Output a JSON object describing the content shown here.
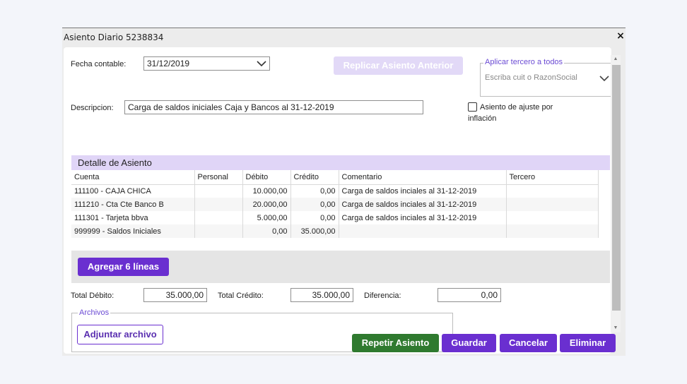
{
  "window": {
    "title": "Asiento Diario 5238834",
    "close_label": "×"
  },
  "form": {
    "fecha_label": "Fecha contable:",
    "fecha_value": "31/12/2019",
    "replicar_label": "Replicar Asiento Anterior",
    "tercero_legend": "Aplicar tercero a todos",
    "tercero_placeholder": "Escriba cuit o RazonSocial",
    "descripcion_label": "Descripcion:",
    "descripcion_value": "Carga de saldos iniciales Caja y Bancos al 31-12-2019",
    "ajuste_label_line1": "Asiento de ajuste por",
    "ajuste_label_line2": "inflación",
    "ajuste_checked": false
  },
  "detalle": {
    "title": "Detalle de Asiento",
    "columns": [
      "Cuenta",
      "Personal",
      "Débito",
      "Crédito",
      "Comentario",
      "Tercero"
    ],
    "rows": [
      [
        "111100 - CAJA CHICA",
        "",
        "10.000,00",
        "0,00",
        "Carga de saldos inciales al 31-12-2019",
        ""
      ],
      [
        "111210 - Cta Cte Banco B",
        "",
        "20.000,00",
        "0,00",
        "Carga de saldos inciales al 31-12-2019",
        ""
      ],
      [
        "111301 - Tarjeta bbva",
        "",
        "5.000,00",
        "0,00",
        "Carga de saldos inciales al 31-12-2019",
        ""
      ],
      [
        "999999 - Saldos Iniciales",
        "",
        "0,00",
        "35.000,00",
        "",
        ""
      ]
    ],
    "agregar_label": "Agregar 6 líneas"
  },
  "totales": {
    "debito_label": "Total Débito:",
    "debito_value": "35.000,00",
    "credito_label": "Total Crédito:",
    "credito_value": "35.000,00",
    "diferencia_label": "Diferencia:",
    "diferencia_value": "0,00"
  },
  "archivos": {
    "legend": "Archivos",
    "adjuntar_label": "Adjuntar archivo"
  },
  "actions": {
    "repetir": "Repetir Asiento",
    "guardar": "Guardar",
    "cancelar": "Cancelar",
    "eliminar": "Eliminar"
  },
  "colors": {
    "primary": "#6a2fd0",
    "success": "#2f7a2f",
    "disabled_primary": "#e2d9f7",
    "section_header": "#e0d5f7"
  },
  "icons": {
    "dropdown": "chevron-down-icon",
    "close": "close-icon"
  }
}
